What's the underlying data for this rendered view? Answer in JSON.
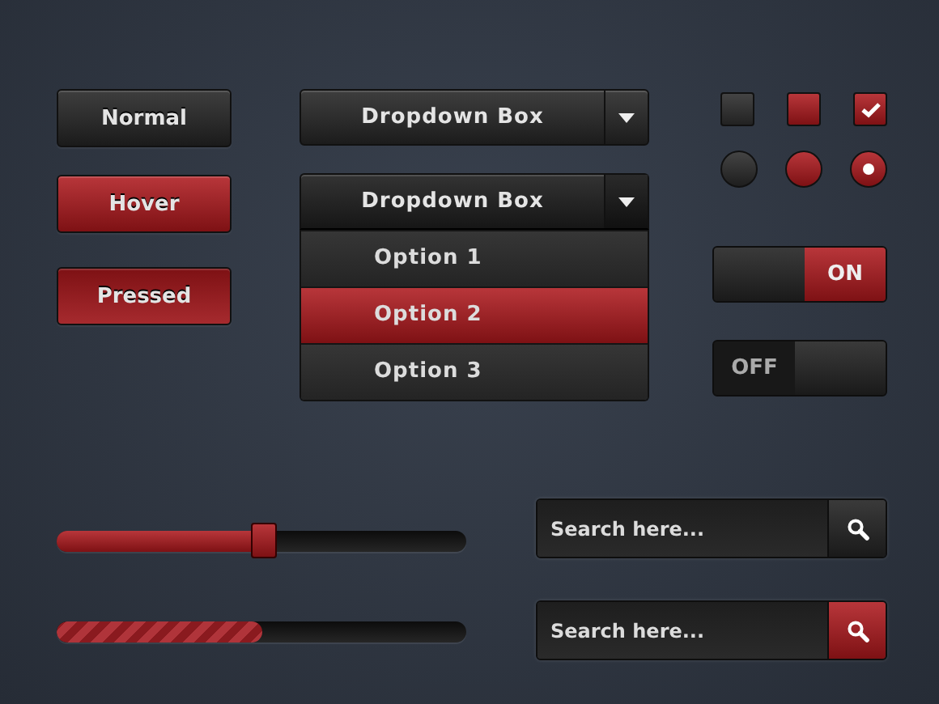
{
  "buttons": [
    {
      "label": "Normal",
      "kind": "normal"
    },
    {
      "label": "Hover",
      "kind": "hover"
    },
    {
      "label": "Pressed",
      "kind": "pressed"
    }
  ],
  "dropdowns": [
    {
      "value": "Dropdown Box",
      "expanded": false
    },
    {
      "value": "Dropdown Box",
      "expanded": true,
      "options": [
        {
          "label": "Option 1",
          "selected": false
        },
        {
          "label": "Option 2",
          "selected": true
        },
        {
          "label": "Option 3",
          "selected": false
        }
      ]
    }
  ],
  "checkboxes": [
    {
      "checked": false,
      "highlighted": false
    },
    {
      "checked": false,
      "highlighted": true
    },
    {
      "checked": true,
      "highlighted": true
    }
  ],
  "radios": [
    {
      "checked": false,
      "highlighted": false
    },
    {
      "checked": false,
      "highlighted": true
    },
    {
      "checked": true,
      "highlighted": true
    }
  ],
  "toggles": [
    {
      "label": "ON",
      "on": true
    },
    {
      "label": "OFF",
      "on": false
    }
  ],
  "slider": {
    "level": 0.5
  },
  "progress": {
    "level": 0.5
  },
  "searches": [
    {
      "placeholder": "Search here...",
      "highlighted": false
    },
    {
      "placeholder": "Search here...",
      "highlighted": true
    }
  ]
}
